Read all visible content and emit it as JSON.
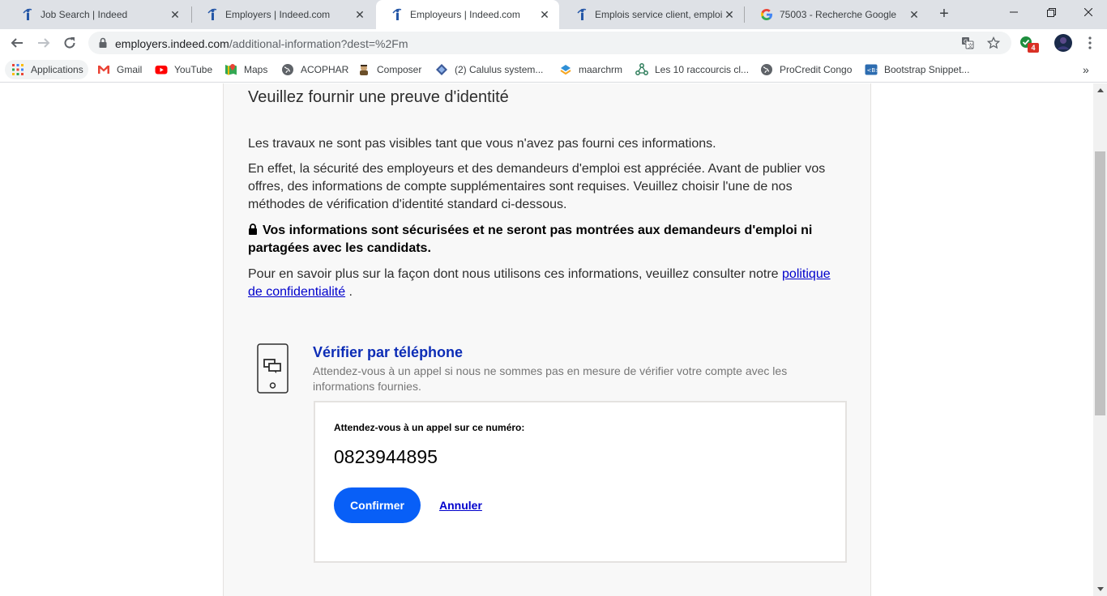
{
  "browser": {
    "tabs": [
      {
        "title": "Job Search | Indeed",
        "icon": "indeed-icon",
        "active": false
      },
      {
        "title": "Employers | Indeed.com",
        "icon": "indeed-icon",
        "active": false
      },
      {
        "title": "Employeurs | Indeed.com",
        "icon": "indeed-icon",
        "active": true
      },
      {
        "title": "Emplois service client, emploi |",
        "icon": "indeed-icon",
        "active": false
      },
      {
        "title": "75003 - Recherche Google",
        "icon": "google-icon",
        "active": false
      }
    ],
    "url_host": "employers.indeed.com",
    "url_path": "/additional-information?dest=%2Fm",
    "extension_badge": "4",
    "bookmarks": [
      {
        "label": "Applications",
        "icon": "apps-grid-icon"
      },
      {
        "label": "Gmail",
        "icon": "gmail-icon"
      },
      {
        "label": "YouTube",
        "icon": "youtube-icon"
      },
      {
        "label": "Maps",
        "icon": "maps-icon"
      },
      {
        "label": "ACOPHAR",
        "icon": "globe-icon"
      },
      {
        "label": "Composer",
        "icon": "composer-icon"
      },
      {
        "label": "(2) Calulus system...",
        "icon": "calculus-icon"
      },
      {
        "label": "maarchrm",
        "icon": "maarch-icon"
      },
      {
        "label": "Les 10 raccourcis cl...",
        "icon": "network-icon"
      },
      {
        "label": "ProCredit Congo",
        "icon": "globe-icon"
      },
      {
        "label": "Bootstrap Snippet...",
        "icon": "bootstrap-icon"
      }
    ],
    "colors": {
      "accent": "#1a73e8",
      "tabstrip": "#dee1e6"
    }
  },
  "page": {
    "heading": "Veuillez fournir une preuve d'identité",
    "intro": "Les travaux ne sont pas visibles tant que vous n'avez pas fourni ces informations.",
    "explanation": "En effet, la sécurité des employeurs et des demandeurs d'emploi est appréciée. Avant de publier vos offres, des informations de compte supplémentaires sont requises. Veuillez choisir l'une de nos méthodes de vérification d'identité standard ci-dessous.",
    "security_note": "Vos informations sont sécurisées et ne seront pas montrées aux demandeurs d'emploi ni partagées avec les candidats.",
    "privacy_prefix": "Pour en savoir plus sur la façon dont nous utilisons ces informations, veuillez consulter notre ",
    "privacy_link": "politique de confidentialité",
    "privacy_suffix": " .",
    "verify": {
      "title": "Vérifier par téléphone",
      "description": "Attendez-vous à un appel si nous ne sommes pas en mesure de vérifier votre compte avec les informations fournies.",
      "call_label": "Attendez-vous à un appel sur ce numéro:",
      "phone_number": "0823944895",
      "confirm_label": "Confirmer",
      "cancel_label": "Annuler"
    },
    "colors": {
      "primary_button": "#085ff7",
      "link": "#0000cc",
      "verify_title": "#0d2db6"
    }
  }
}
